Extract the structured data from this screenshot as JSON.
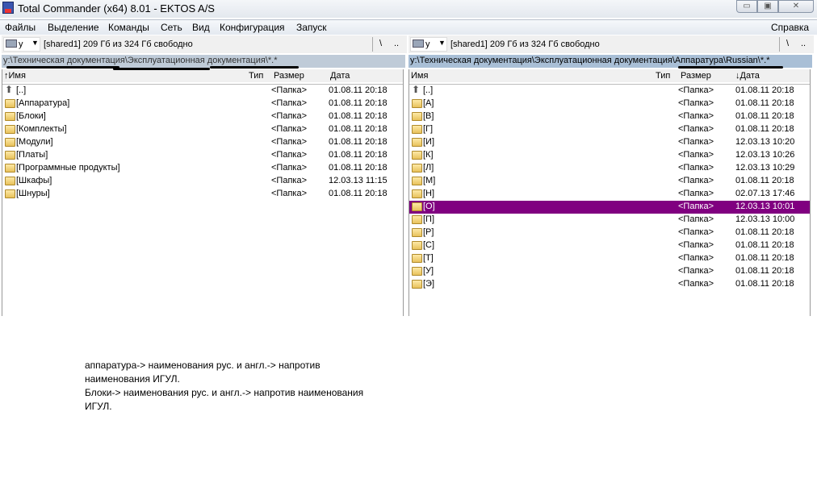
{
  "window": {
    "title": "Total Commander (x64) 8.01 - EKTOS A/S",
    "min": "▭",
    "max": "▣",
    "close": "✕"
  },
  "menu": [
    "Файлы",
    "Выделение",
    "Команды",
    "Сеть",
    "Вид",
    "Конфигурация",
    "Запуск"
  ],
  "menu_help": "Справка",
  "left": {
    "drive": "y",
    "free": "[shared1]  209 Гб из 324 Гб свободно",
    "root": "\\",
    "up": "..",
    "path": "y:\\Техническая документация\\Эксплуатационная документация\\*.*",
    "headers": {
      "name": "Имя",
      "type": "Тип",
      "size": "Размер",
      "date": "Дата"
    },
    "sort_column": "name",
    "rows": [
      {
        "name": "[..]",
        "size": "<Папка>",
        "date": "01.08.11 20:18",
        "icon": "up-folder"
      },
      {
        "name": "[Аппаратура]",
        "size": "<Папка>",
        "date": "01.08.11 20:18"
      },
      {
        "name": "[Блоки]",
        "size": "<Папка>",
        "date": "01.08.11 20:18"
      },
      {
        "name": "[Комплекты]",
        "size": "<Папка>",
        "date": "01.08.11 20:18"
      },
      {
        "name": "[Модули]",
        "size": "<Папка>",
        "date": "01.08.11 20:18"
      },
      {
        "name": "[Платы]",
        "size": "<Папка>",
        "date": "01.08.11 20:18"
      },
      {
        "name": "[Программные продукты]",
        "size": "<Папка>",
        "date": "01.08.11 20:18"
      },
      {
        "name": "[Шкафы]",
        "size": "<Папка>",
        "date": "12.03.13 11:15"
      },
      {
        "name": "[Шнуры]",
        "size": "<Папка>",
        "date": "01.08.11 20:18"
      }
    ]
  },
  "right": {
    "drive": "y",
    "free": "[shared1]  209 Гб из 324 Гб свободно",
    "root": "\\",
    "up": "..",
    "path": "y:\\Техническая документация\\Эксплуатационная документация\\Аппаратура\\Russian\\*.*",
    "headers": {
      "name": "Имя",
      "type": "Тип",
      "size": "Размер",
      "date": "Дата"
    },
    "sort_column": "date",
    "selected_index": 9,
    "selection_color": "#800080",
    "rows": [
      {
        "name": "[..]",
        "size": "<Папка>",
        "date": "01.08.11 20:18",
        "icon": "up-folder"
      },
      {
        "name": "[А]",
        "size": "<Папка>",
        "date": "01.08.11 20:18"
      },
      {
        "name": "[В]",
        "size": "<Папка>",
        "date": "01.08.11 20:18"
      },
      {
        "name": "[Г]",
        "size": "<Папка>",
        "date": "01.08.11 20:18"
      },
      {
        "name": "[И]",
        "size": "<Папка>",
        "date": "12.03.13 10:20"
      },
      {
        "name": "[К]",
        "size": "<Папка>",
        "date": "12.03.13 10:26"
      },
      {
        "name": "[Л]",
        "size": "<Папка>",
        "date": "12.03.13 10:29"
      },
      {
        "name": "[М]",
        "size": "<Папка>",
        "date": "01.08.11 20:18"
      },
      {
        "name": "[Н]",
        "size": "<Папка>",
        "date": "02.07.13 17:46"
      },
      {
        "name": "[О]",
        "size": "<Папка>",
        "date": "12.03.13 10:01"
      },
      {
        "name": "[П]",
        "size": "<Папка>",
        "date": "12.03.13 10:00"
      },
      {
        "name": "[Р]",
        "size": "<Папка>",
        "date": "01.08.11 20:18"
      },
      {
        "name": "[С]",
        "size": "<Папка>",
        "date": "01.08.11 20:18"
      },
      {
        "name": "[Т]",
        "size": "<Папка>",
        "date": "01.08.11 20:18"
      },
      {
        "name": "[У]",
        "size": "<Папка>",
        "date": "01.08.11 20:18"
      },
      {
        "name": "[Э]",
        "size": "<Папка>",
        "date": "01.08.11 20:18"
      }
    ]
  },
  "note": [
    "аппаратура-> наименования рус. и англ.-> напротив",
    "наименования ИГУЛ.",
    "Блоки-> наименования рус. и англ.-> напротив наименования",
    "ИГУЛ."
  ]
}
